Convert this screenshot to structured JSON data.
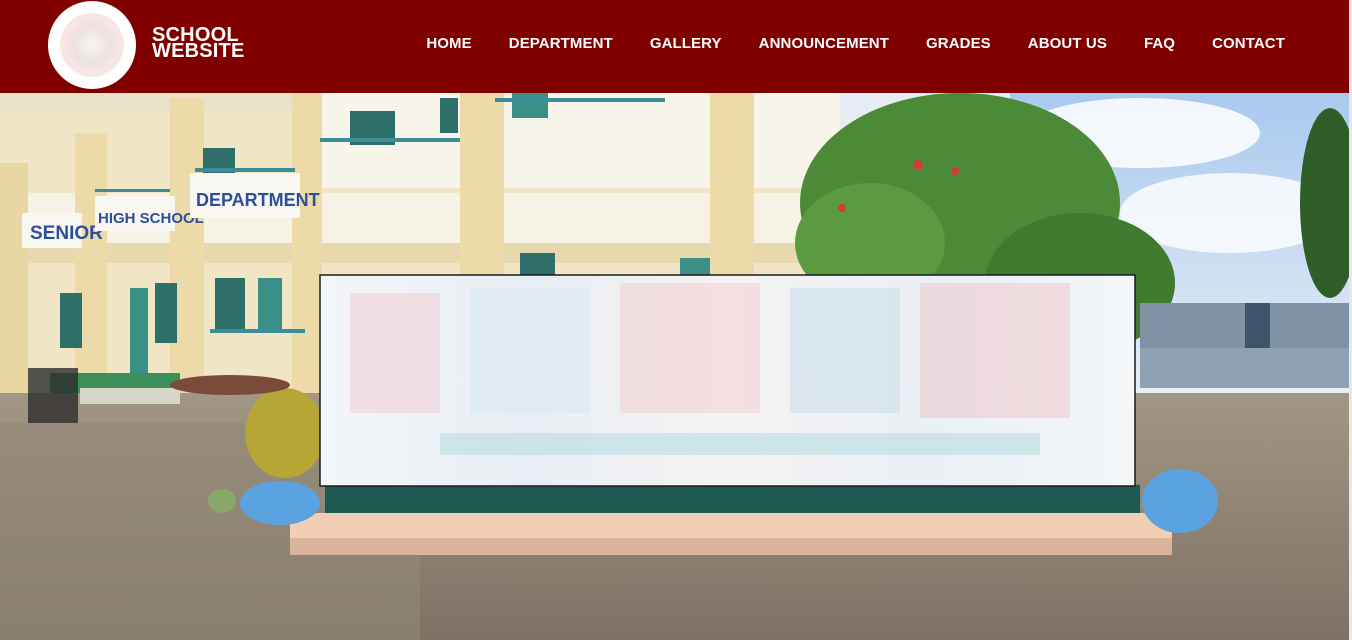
{
  "brand": {
    "line1": "SCHOOL",
    "line2": "WEBSITE"
  },
  "nav": {
    "items": [
      "HOME",
      "DEPARTMENT",
      "GALLERY",
      "ANNOUNCEMENT",
      "GRADES",
      "ABOUT US",
      "FAQ",
      "CONTACT"
    ]
  },
  "hero": {
    "building_signs": [
      "SENIOR",
      "HIGH SCHOOL",
      "DEPARTMENT"
    ]
  },
  "colors": {
    "nav_bg": "#800000",
    "nav_text": "#ffffff"
  }
}
